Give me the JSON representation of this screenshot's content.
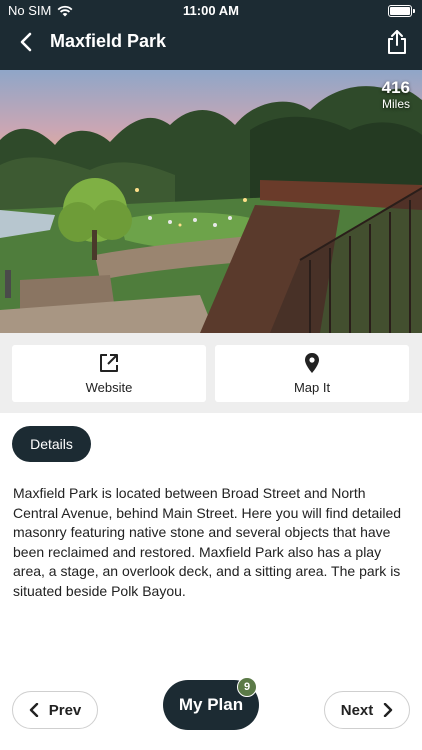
{
  "status_bar": {
    "carrier": "No SIM",
    "time": "11:00 AM"
  },
  "header": {
    "title": "Maxfield Park"
  },
  "hero": {
    "distance_value": "416",
    "distance_unit": "Miles"
  },
  "actions": {
    "website_label": "Website",
    "mapit_label": "Map It"
  },
  "details": {
    "tab_label": "Details",
    "description": "Maxfield Park is located between Broad Street and North Central Avenue, behind Main Street. Here you will find detailed masonry featuring native stone and several objects that have been reclaimed and restored. Maxfield Park also has a play area, a stage, an overlook deck, and a sitting area. The park is situated beside Polk Bayou."
  },
  "footer": {
    "prev_label": "Prev",
    "next_label": "Next",
    "myplan_label": "My Plan",
    "myplan_count": "9"
  },
  "colors": {
    "header_bg": "#1c2b33",
    "badge_green": "#5b7a47",
    "action_bar_bg": "#eeeeee"
  },
  "icons": [
    "wifi-icon",
    "battery-icon",
    "back-arrow-icon",
    "share-icon",
    "external-link-icon",
    "map-pin-icon",
    "chevron-left-icon",
    "chevron-right-icon"
  ]
}
